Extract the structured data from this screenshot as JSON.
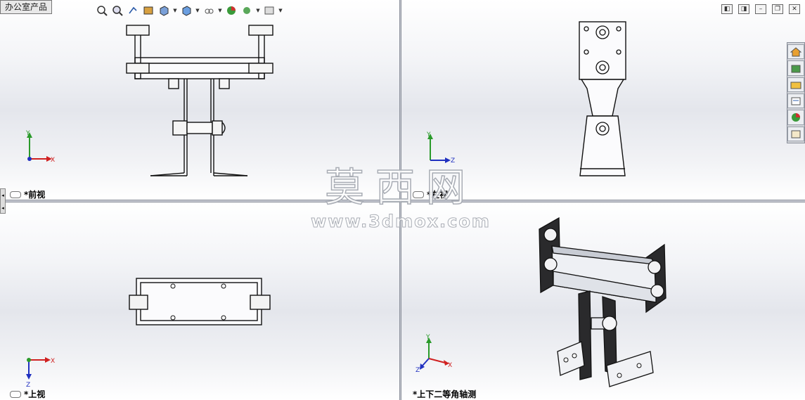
{
  "app": {
    "doc_tab": "办公室产品"
  },
  "toolbar": {
    "items": [
      "zoom-to-fit-icon",
      "zoom-area-icon",
      "rotate-view-icon",
      "section-view-icon",
      "view-orientation-icon",
      "display-style-icon",
      "hide-show-icon",
      "appearance-icon",
      "scene-icon",
      "view-settings-icon"
    ]
  },
  "window_controls": [
    "tile-h",
    "tile-v",
    "minimize",
    "restore",
    "close"
  ],
  "viewports": {
    "front": {
      "label": "*前视",
      "axes": [
        "Y",
        "X"
      ]
    },
    "left": {
      "label": "*左视",
      "axes": [
        "Y",
        "Z"
      ]
    },
    "top": {
      "label": "*上视",
      "axes": [
        "X",
        "Z"
      ]
    },
    "iso": {
      "label": "*上下二等角轴测",
      "axes": [
        "Y",
        "X",
        "Z"
      ]
    }
  },
  "taskpane": [
    "home-icon",
    "design-library-icon",
    "file-explorer-icon",
    "view-palette-icon",
    "appearances-icon",
    "custom-properties-icon"
  ],
  "watermark": {
    "title": "莫西网",
    "url": "www.3dmox.com"
  },
  "colors": {
    "axis_y": "#2a9a2a",
    "axis_x": "#d02020",
    "axis_z": "#2030c0"
  }
}
